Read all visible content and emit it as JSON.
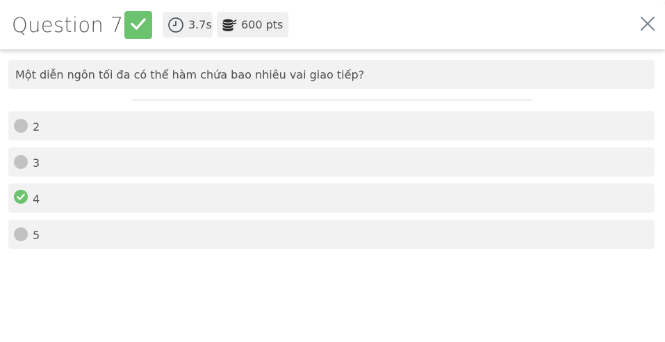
{
  "header": {
    "title": "Question 7",
    "status_icon": "check-icon",
    "time": {
      "icon": "clock-icon",
      "value": "3.7s"
    },
    "points": {
      "icon": "coins-icon",
      "value": "600 pts"
    },
    "close_icon": "close-icon"
  },
  "question": {
    "text": "Một diễn ngôn tối đa có thể hàm chứa bao nhiêu vai giao tiếp?"
  },
  "options": [
    {
      "label": "2",
      "state": "unselected"
    },
    {
      "label": "3",
      "state": "unselected"
    },
    {
      "label": "4",
      "state": "correct"
    },
    {
      "label": "5",
      "state": "unselected"
    }
  ],
  "colors": {
    "correct": "#6bc26f",
    "option_bg": "#f2f2f2",
    "radio": "#c2c2c2",
    "close": "#7a8a96"
  }
}
